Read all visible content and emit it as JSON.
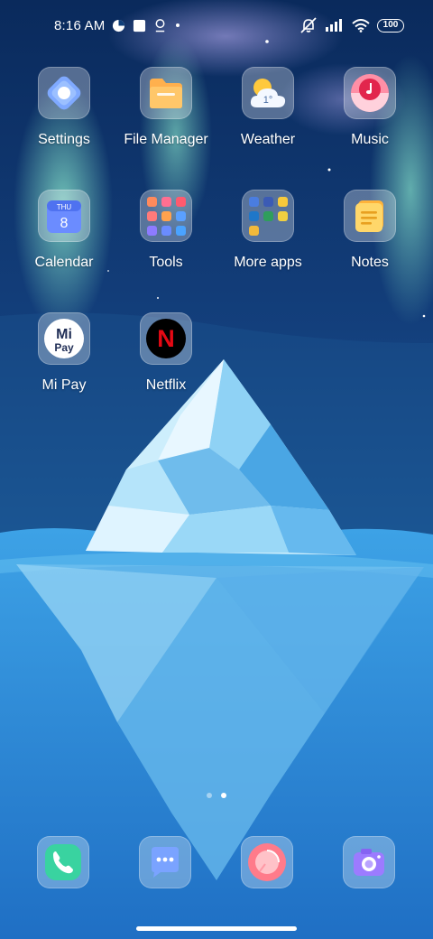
{
  "status_bar": {
    "time": "8:16 AM",
    "battery": "100",
    "icons": [
      "data-saver-icon",
      "notification-square-icon",
      "location-icon",
      "dot-icon",
      "mute-icon",
      "signal-icon",
      "wifi-icon",
      "battery-icon"
    ]
  },
  "apps": [
    {
      "label": "Settings",
      "icon": "settings-icon"
    },
    {
      "label": "File Manager",
      "icon": "folder-icon"
    },
    {
      "label": "Weather",
      "icon": "weather-icon",
      "temp": "1°"
    },
    {
      "label": "Music",
      "icon": "music-icon"
    },
    {
      "label": "Calendar",
      "icon": "calendar-icon",
      "weekday": "THU",
      "day": "8"
    },
    {
      "label": "Tools",
      "icon": "tools-folder-icon"
    },
    {
      "label": "More apps",
      "icon": "more-apps-folder-icon"
    },
    {
      "label": "Notes",
      "icon": "notes-icon"
    },
    {
      "label": "Mi Pay",
      "icon": "mi-pay-icon",
      "line1": "Mi",
      "line2": "Pay"
    },
    {
      "label": "Netflix",
      "icon": "netflix-icon",
      "glyph": "N"
    }
  ],
  "dock": [
    {
      "name": "phone",
      "icon": "phone-icon"
    },
    {
      "name": "messages",
      "icon": "messages-icon"
    },
    {
      "name": "browser",
      "icon": "browser-icon"
    },
    {
      "name": "camera",
      "icon": "camera-icon"
    }
  ],
  "pager": {
    "pages": 2,
    "active": 2
  },
  "colors": {
    "sky_top": "#0c2f63",
    "sky_mid": "#17548f",
    "aurora": "#7ee0c4",
    "sea": "#2f8fda",
    "ice": "#a8dcf6",
    "netflix_red": "#e50914"
  }
}
